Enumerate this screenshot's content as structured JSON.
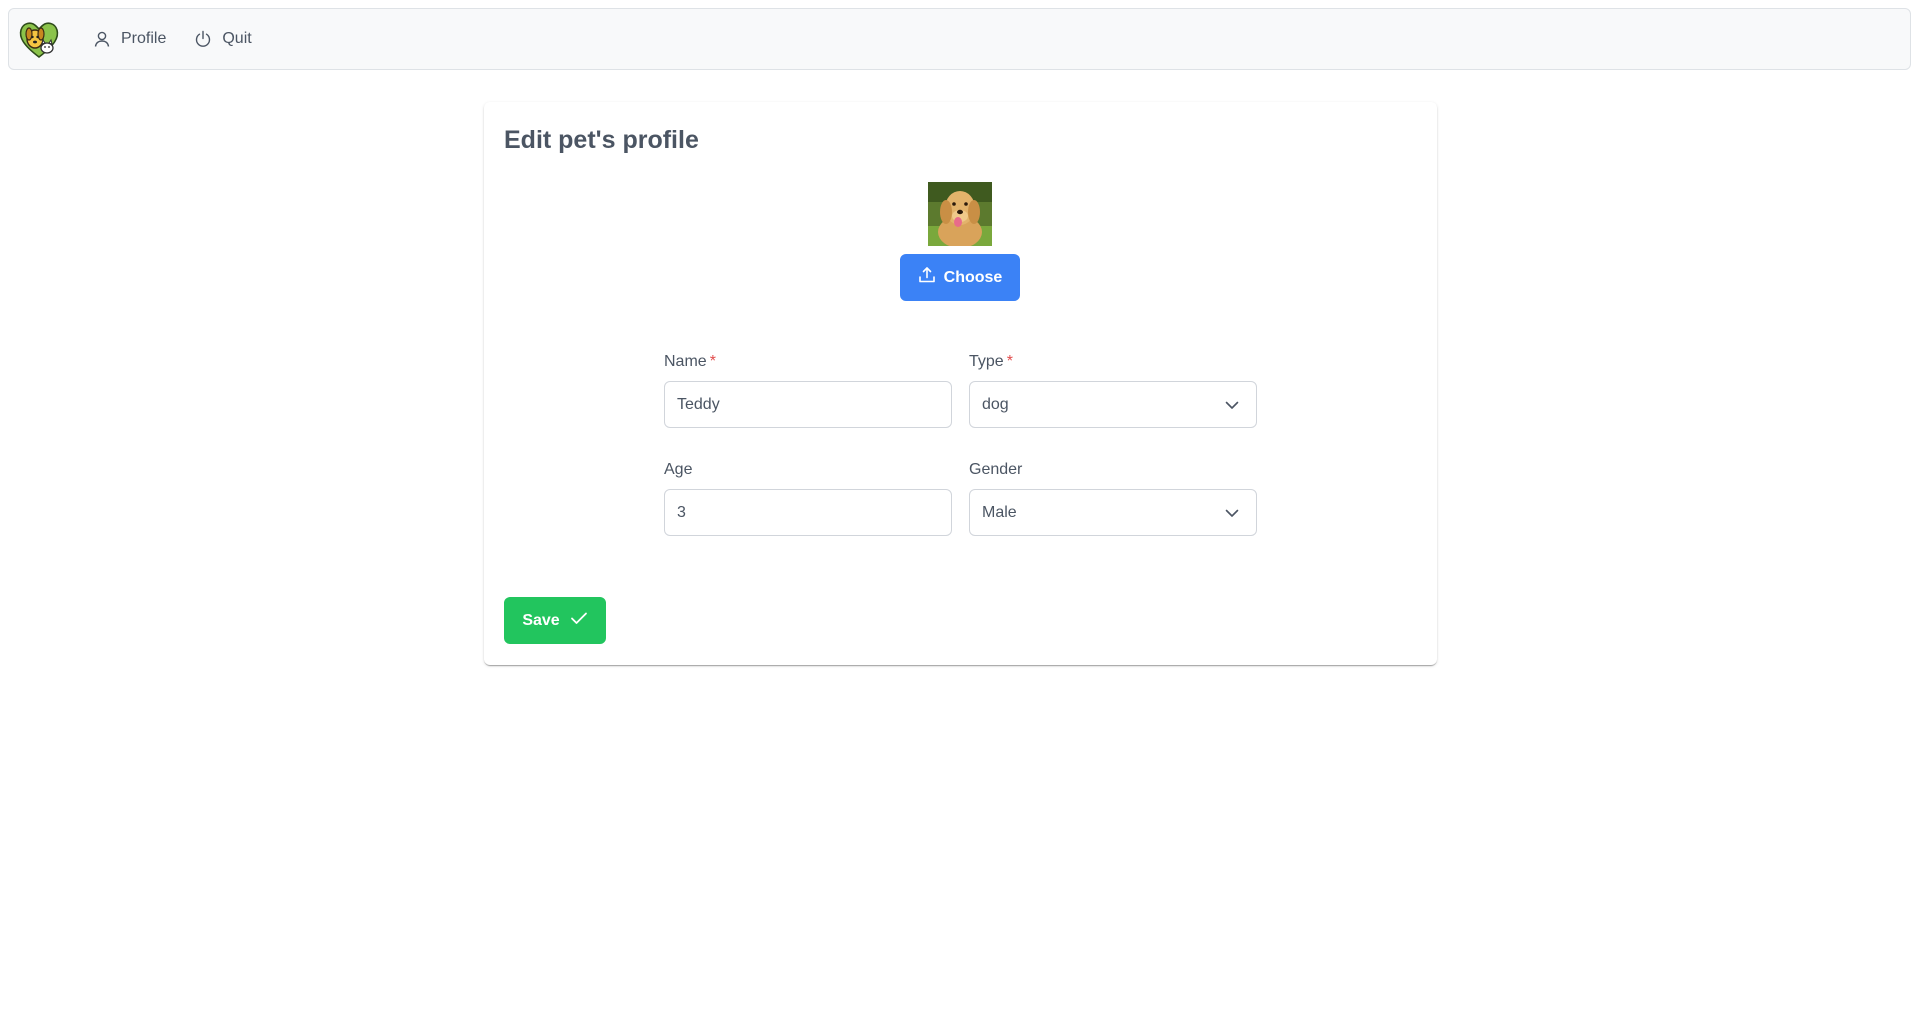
{
  "menubar": {
    "logo_icon": "pet-heart-logo",
    "items": [
      {
        "label": "Profile",
        "icon": "user-icon"
      },
      {
        "label": "Quit",
        "icon": "power-icon"
      }
    ]
  },
  "card": {
    "title": "Edit pet's profile",
    "photo_icon": "dog-photo",
    "choose_label": "Choose",
    "choose_icon": "upload-icon"
  },
  "form": {
    "name": {
      "label": "Name",
      "required_mark": "*",
      "value": "Teddy"
    },
    "type": {
      "label": "Type",
      "required_mark": "*",
      "value": "dog"
    },
    "age": {
      "label": "Age",
      "value": "3"
    },
    "gender": {
      "label": "Gender",
      "value": "Male"
    }
  },
  "actions": {
    "save_label": "Save",
    "save_icon": "check-icon"
  },
  "colors": {
    "primary": "#3b82f6",
    "success": "#22c55e",
    "required": "#e24c4c",
    "text": "#4b5563",
    "menubar_bg": "#f8f9fa"
  }
}
